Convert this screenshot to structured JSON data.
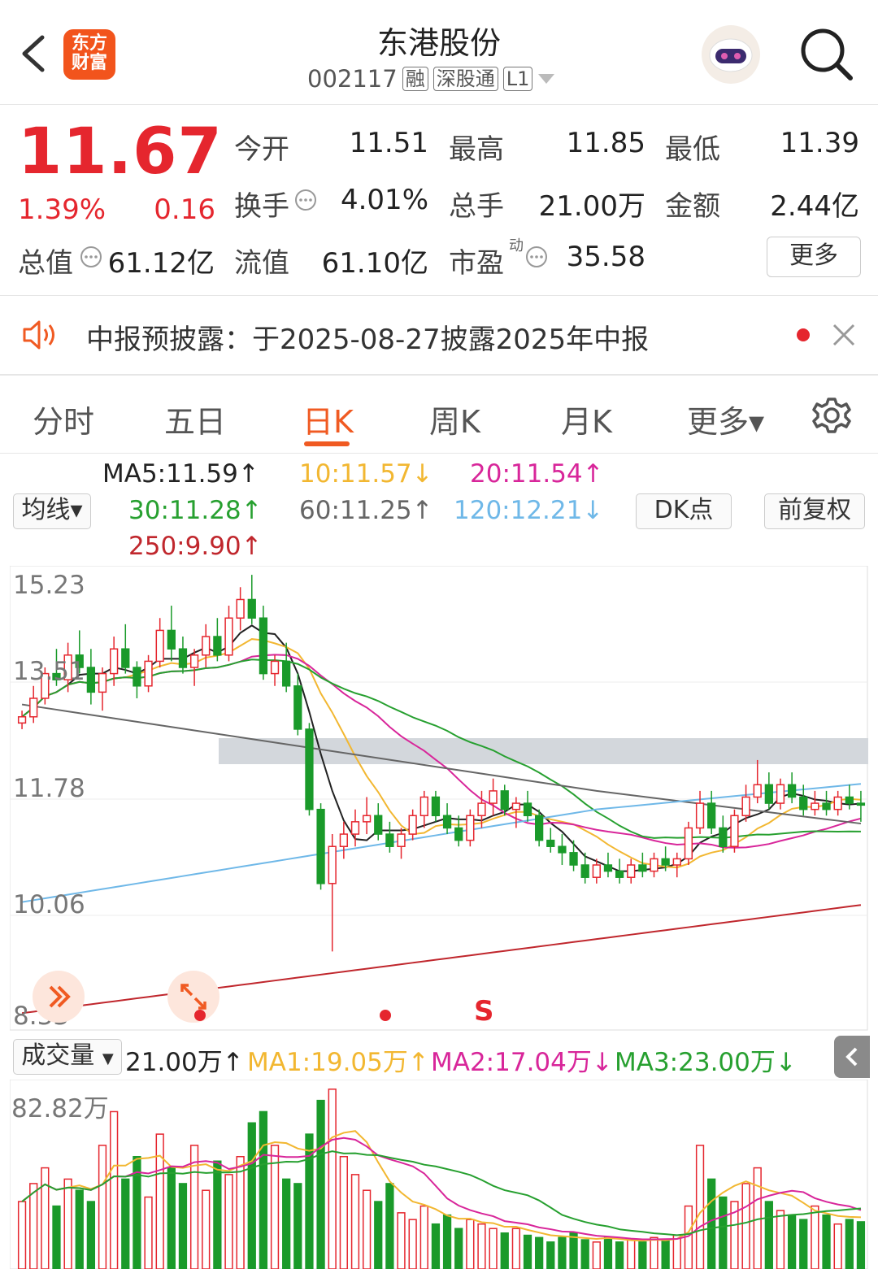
{
  "header": {
    "logo_text_line1": "东方",
    "logo_text_line2": "财富",
    "stock_name": "东港股份",
    "stock_code": "002117",
    "tags": [
      "融",
      "深股通",
      "L1"
    ],
    "back_icon": "chevron-left-icon",
    "assistant_icon": "robot-avatar-icon",
    "search_icon": "search-icon"
  },
  "quote": {
    "price": "11.67",
    "change_pct": "1.39%",
    "change_amt": "0.16",
    "open_label": "今开",
    "open": "11.51",
    "high_label": "最高",
    "high": "11.85",
    "low_label": "最低",
    "low": "11.39",
    "turnover_label": "换手",
    "turnover": "4.01%",
    "volume_label": "总手",
    "volume": "21.00万",
    "amount_label": "金额",
    "amount": "2.44亿",
    "mktcap_label": "总值",
    "mktcap": "61.12亿",
    "float_label": "流值",
    "float_cap": "61.10亿",
    "pe_label": "市盈",
    "pe_sup": "动",
    "pe": "35.58",
    "more_label": "更多"
  },
  "notice": {
    "text": "中报预披露：于2025-08-27披露2025年中报",
    "speaker_icon": "speaker-icon",
    "close_icon": "close-icon"
  },
  "tabs": [
    {
      "label": "分时",
      "active": false
    },
    {
      "label": "五日",
      "active": false
    },
    {
      "label": "日K",
      "active": true
    },
    {
      "label": "周K",
      "active": false
    },
    {
      "label": "月K",
      "active": false
    },
    {
      "label": "更多▾",
      "active": false
    }
  ],
  "settings_icon": "gear-icon",
  "ma_bar": {
    "select_label": "均线▾",
    "ma5": "MA5:11.59↑",
    "ma10": "10:11.57↓",
    "ma20": "20:11.54↑",
    "ma30": "30:11.28↑",
    "ma60": "60:11.25↑",
    "ma120": "120:12.21↓",
    "ma250": "250:9.90↑",
    "dk_label": "DK点",
    "adjust_label": "前复权"
  },
  "colors": {
    "up": "#e5262e",
    "down": "#1a9a2a",
    "ma5": "#222222",
    "ma10": "#f2b731",
    "ma20": "#d8269a",
    "ma30": "#27a030",
    "ma60": "#666666",
    "ma120": "#6fb8e8",
    "ma250": "#c0272d",
    "accent": "#f05a22"
  },
  "price_axis": [
    "15.23",
    "13.51",
    "11.78",
    "10.06",
    "8.33"
  ],
  "signals": [
    "S"
  ],
  "volume_bar": {
    "select_label": "成交量",
    "vol": "21.00万↑",
    "ma1": "MA1:19.05万↑",
    "ma2": "MA2:17.04万↓",
    "ma3": "MA3:23.00万↓",
    "axis_max": "82.82万",
    "collapse_icon": "chevron-left-icon"
  },
  "chart_data": {
    "type": "candlestick",
    "ylim": [
      8.33,
      15.23
    ],
    "ma_ylim": [
      8.33,
      15.23
    ],
    "candles_ohlc": [
      [
        13.0,
        13.2,
        12.9,
        13.1
      ],
      [
        13.1,
        13.6,
        13.0,
        13.4
      ],
      [
        13.4,
        13.9,
        13.3,
        13.8
      ],
      [
        13.8,
        14.2,
        13.6,
        13.7
      ],
      [
        13.7,
        14.3,
        13.5,
        14.1
      ],
      [
        14.1,
        14.5,
        13.8,
        13.9
      ],
      [
        13.9,
        14.2,
        13.3,
        13.5
      ],
      [
        13.5,
        13.9,
        13.2,
        13.8
      ],
      [
        13.8,
        14.4,
        13.6,
        14.2
      ],
      [
        14.2,
        14.6,
        13.8,
        13.9
      ],
      [
        13.9,
        14.0,
        13.4,
        13.6
      ],
      [
        13.6,
        14.1,
        13.5,
        14.0
      ],
      [
        14.0,
        14.7,
        13.9,
        14.5
      ],
      [
        14.5,
        14.9,
        14.0,
        14.2
      ],
      [
        14.2,
        14.4,
        13.8,
        13.9
      ],
      [
        13.9,
        14.2,
        13.6,
        14.1
      ],
      [
        14.1,
        14.6,
        13.9,
        14.4
      ],
      [
        14.4,
        14.7,
        14.0,
        14.1
      ],
      [
        14.1,
        14.9,
        14.0,
        14.7
      ],
      [
        14.7,
        15.2,
        14.5,
        15.0
      ],
      [
        15.0,
        15.4,
        14.6,
        14.7
      ],
      [
        14.7,
        14.9,
        13.7,
        13.8
      ],
      [
        13.8,
        14.1,
        13.6,
        14.0
      ],
      [
        14.0,
        14.3,
        13.5,
        13.6
      ],
      [
        13.6,
        13.8,
        12.8,
        12.9
      ],
      [
        12.9,
        13.0,
        11.5,
        11.6
      ],
      [
        11.6,
        11.7,
        10.3,
        10.4
      ],
      [
        10.4,
        11.2,
        9.3,
        11.0
      ],
      [
        11.0,
        11.4,
        10.8,
        11.2
      ],
      [
        11.2,
        11.6,
        11.0,
        11.4
      ],
      [
        11.4,
        11.8,
        11.2,
        11.5
      ],
      [
        11.5,
        11.7,
        11.1,
        11.2
      ],
      [
        11.2,
        11.4,
        10.9,
        11.0
      ],
      [
        11.0,
        11.3,
        10.8,
        11.2
      ],
      [
        11.2,
        11.6,
        11.1,
        11.5
      ],
      [
        11.5,
        11.9,
        11.3,
        11.8
      ],
      [
        11.8,
        11.9,
        11.4,
        11.5
      ],
      [
        11.5,
        11.7,
        11.2,
        11.3
      ],
      [
        11.3,
        11.5,
        11.0,
        11.1
      ],
      [
        11.1,
        11.6,
        11.0,
        11.5
      ],
      [
        11.5,
        11.9,
        11.3,
        11.7
      ],
      [
        11.7,
        12.1,
        11.5,
        11.9
      ],
      [
        11.9,
        12.0,
        11.5,
        11.6
      ],
      [
        11.6,
        11.8,
        11.3,
        11.7
      ],
      [
        11.7,
        11.9,
        11.4,
        11.5
      ],
      [
        11.5,
        11.6,
        11.0,
        11.1
      ],
      [
        11.1,
        11.3,
        10.9,
        11.0
      ],
      [
        11.0,
        11.2,
        10.7,
        10.9
      ],
      [
        10.9,
        11.1,
        10.6,
        10.7
      ],
      [
        10.7,
        10.9,
        10.4,
        10.5
      ],
      [
        10.5,
        10.8,
        10.4,
        10.7
      ],
      [
        10.7,
        10.9,
        10.5,
        10.6
      ],
      [
        10.6,
        10.8,
        10.4,
        10.5
      ],
      [
        10.5,
        10.8,
        10.4,
        10.7
      ],
      [
        10.7,
        10.9,
        10.5,
        10.6
      ],
      [
        10.6,
        10.9,
        10.5,
        10.8
      ],
      [
        10.8,
        11.0,
        10.6,
        10.7
      ],
      [
        10.7,
        10.9,
        10.5,
        10.8
      ],
      [
        10.8,
        11.4,
        10.7,
        11.3
      ],
      [
        11.3,
        11.9,
        11.2,
        11.7
      ],
      [
        11.7,
        11.9,
        11.2,
        11.3
      ],
      [
        11.3,
        11.5,
        10.9,
        11.0
      ],
      [
        11.0,
        11.6,
        10.9,
        11.5
      ],
      [
        11.5,
        12.0,
        11.4,
        11.8
      ],
      [
        11.8,
        12.4,
        11.7,
        12.0
      ],
      [
        12.0,
        12.2,
        11.6,
        11.7
      ],
      [
        11.7,
        12.1,
        11.6,
        12.0
      ],
      [
        12.0,
        12.2,
        11.7,
        11.8
      ],
      [
        11.8,
        12.0,
        11.5,
        11.6
      ],
      [
        11.6,
        11.9,
        11.5,
        11.7
      ],
      [
        11.7,
        11.9,
        11.5,
        11.6
      ],
      [
        11.6,
        11.9,
        11.5,
        11.8
      ],
      [
        11.8,
        12.0,
        11.6,
        11.7
      ],
      [
        11.7,
        11.9,
        11.4,
        11.67
      ]
    ],
    "volume_ylim": [
      0,
      82.82
    ],
    "volumes": [
      30,
      38,
      45,
      28,
      40,
      35,
      30,
      55,
      70,
      40,
      50,
      32,
      60,
      45,
      38,
      55,
      35,
      48,
      42,
      50,
      65,
      70,
      55,
      40,
      38,
      60,
      75,
      80,
      50,
      42,
      35,
      30,
      38,
      25,
      22,
      28,
      20,
      24,
      18,
      22,
      20,
      18,
      16,
      18,
      15,
      14,
      12,
      14,
      16,
      13,
      12,
      14,
      12,
      13,
      12,
      14,
      13,
      15,
      28,
      55,
      40,
      32,
      30,
      38,
      45,
      30,
      26,
      24,
      22,
      28,
      24,
      20,
      22,
      21
    ]
  }
}
